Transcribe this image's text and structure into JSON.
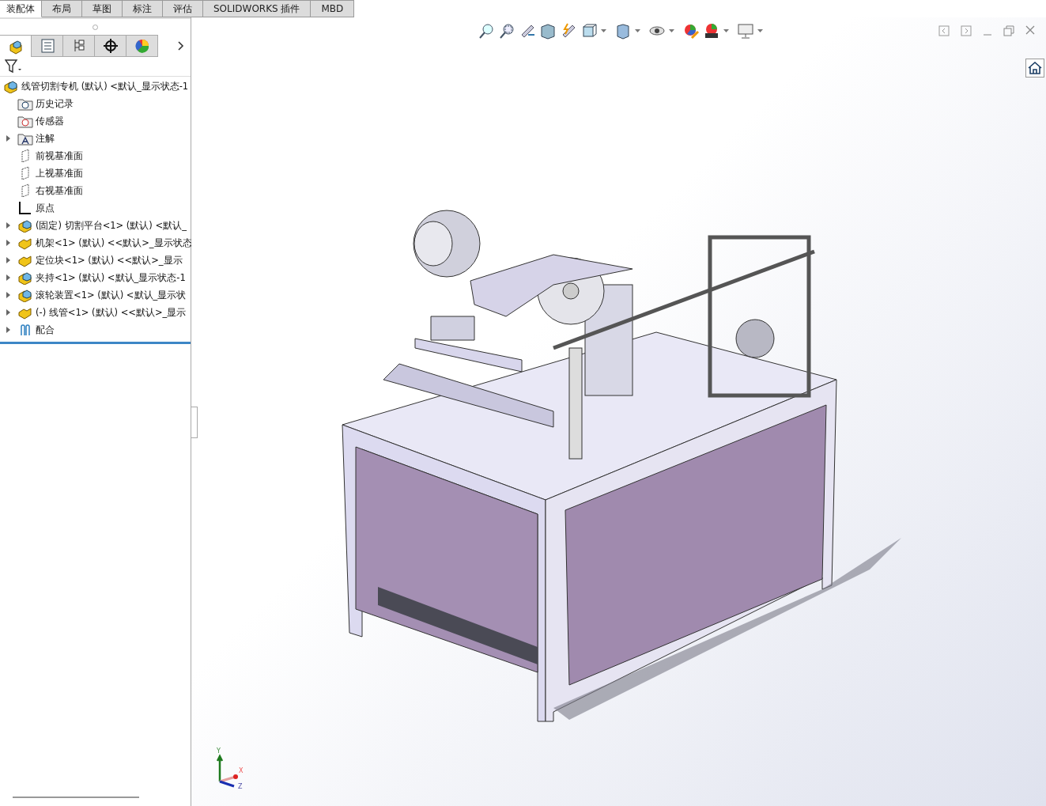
{
  "ribbon_tabs": [
    {
      "label": "装配体",
      "selected": true
    },
    {
      "label": "布局",
      "selected": false
    },
    {
      "label": "草图",
      "selected": false
    },
    {
      "label": "标注",
      "selected": false
    },
    {
      "label": "评估",
      "selected": false
    },
    {
      "label": "SOLIDWORKS 插件",
      "selected": false
    },
    {
      "label": "MBD",
      "selected": false
    }
  ],
  "panel_tabs": [
    {
      "kind": "feature-tree",
      "selected": true
    },
    {
      "kind": "property",
      "selected": false
    },
    {
      "kind": "config",
      "selected": false
    },
    {
      "kind": "dimxpert",
      "selected": false
    },
    {
      "kind": "display",
      "selected": false
    }
  ],
  "feature_tree": [
    {
      "kind": "assembly",
      "label": "线管切割专机 (默认) <默认_显示状态-1",
      "expandable": false
    },
    {
      "kind": "history",
      "label": "历史记录",
      "expandable": false
    },
    {
      "kind": "sensor",
      "label": "传感器",
      "expandable": false
    },
    {
      "kind": "annotation",
      "label": "注解",
      "expandable": true
    },
    {
      "kind": "plane",
      "label": "前视基准面",
      "expandable": false
    },
    {
      "kind": "plane",
      "label": "上视基准面",
      "expandable": false
    },
    {
      "kind": "plane",
      "label": "右视基准面",
      "expandable": false
    },
    {
      "kind": "origin",
      "label": "原点",
      "expandable": false
    },
    {
      "kind": "assembly",
      "label": "(固定) 切割平台<1> (默认) <默认_",
      "expandable": true
    },
    {
      "kind": "part",
      "label": "机架<1> (默认) <<默认>_显示状态",
      "expandable": true
    },
    {
      "kind": "part",
      "label": "定位块<1> (默认) <<默认>_显示",
      "expandable": true
    },
    {
      "kind": "assembly",
      "label": "夹持<1> (默认) <默认_显示状态-1",
      "expandable": true
    },
    {
      "kind": "assembly",
      "label": "滚轮装置<1> (默认) <默认_显示状",
      "expandable": true
    },
    {
      "kind": "part",
      "label": "(-) 线管<1> (默认) <<默认>_显示",
      "expandable": true
    },
    {
      "kind": "mates",
      "label": "配合",
      "expandable": true
    }
  ],
  "triad": {
    "x": "X",
    "y": "Y",
    "z": "Z"
  }
}
